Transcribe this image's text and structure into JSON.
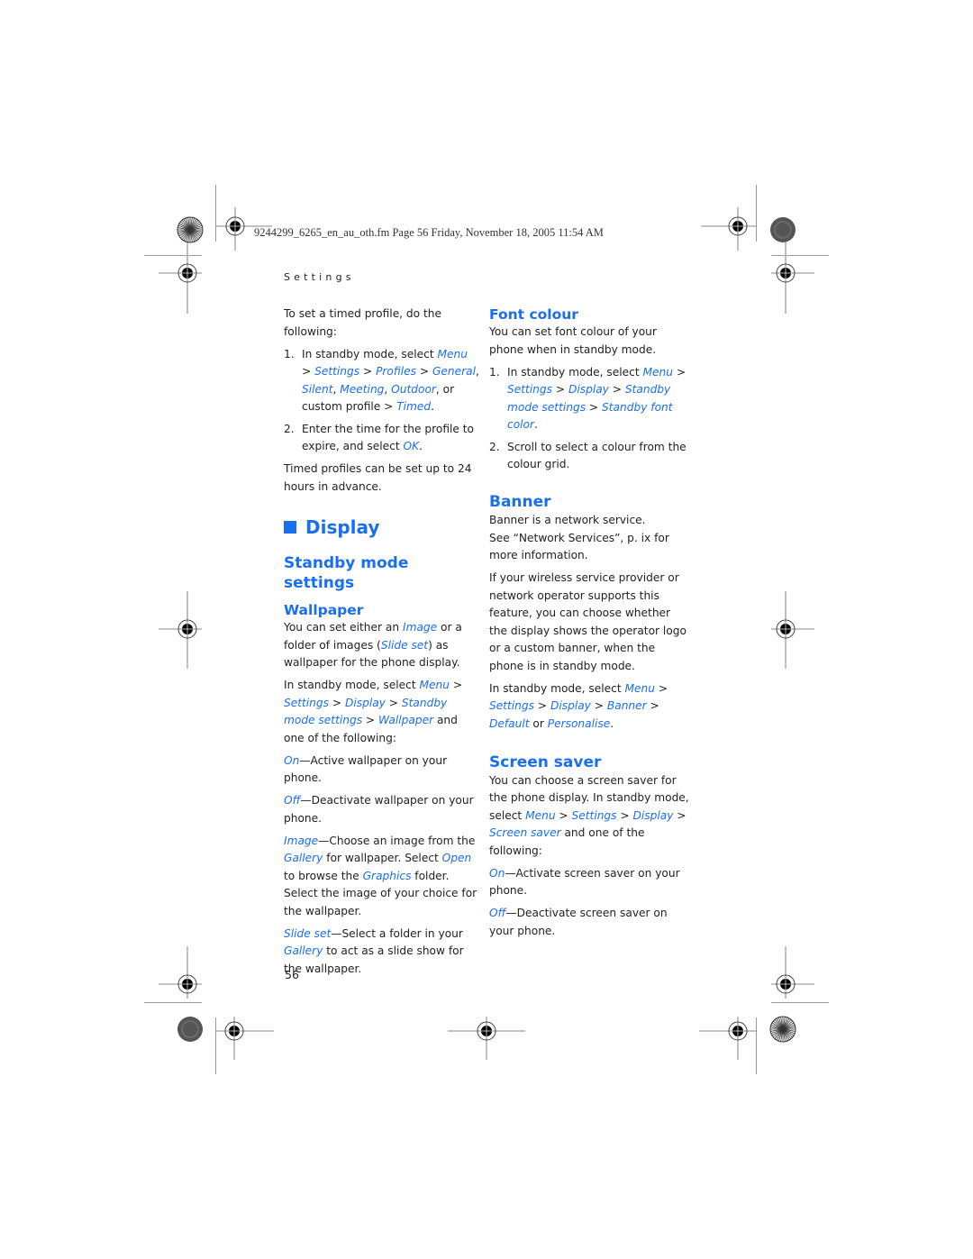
{
  "header": {
    "file_line": "9244299_6265_en_au_oth.fm  Page 56  Friday, November 18, 2005  11:54 AM",
    "running_head": "Settings"
  },
  "left_column": {
    "intro": "To set a timed profile, do the following:",
    "steps": [
      {
        "num": "1.",
        "parts": [
          {
            "t": "In standby mode, select "
          },
          {
            "t": "Menu",
            "link": true
          },
          {
            "t": " > "
          },
          {
            "t": "Settings",
            "link": true
          },
          {
            "t": " > "
          },
          {
            "t": "Profiles",
            "link": true
          },
          {
            "t": " > "
          },
          {
            "t": "General",
            "link": true
          },
          {
            "t": ", "
          },
          {
            "t": "Silent",
            "link": true
          },
          {
            "t": ", "
          },
          {
            "t": "Meeting",
            "link": true
          },
          {
            "t": ", "
          },
          {
            "t": "Outdoor",
            "link": true
          },
          {
            "t": ", or custom profile > "
          },
          {
            "t": "Timed",
            "link": true
          },
          {
            "t": "."
          }
        ]
      },
      {
        "num": "2.",
        "parts": [
          {
            "t": "Enter the time for the profile to expire, and select "
          },
          {
            "t": "OK",
            "link": true
          },
          {
            "t": "."
          }
        ]
      }
    ],
    "timed_note": "Timed profiles can be set up to 24 hours in advance.",
    "display_heading": "Display",
    "standby_heading": "Standby mode settings",
    "wallpaper_heading": "Wallpaper",
    "wallpaper_paras": [
      [
        {
          "t": "You can set either an "
        },
        {
          "t": "Image",
          "link": true
        },
        {
          "t": " or a folder of images ("
        },
        {
          "t": "Slide set",
          "link": true
        },
        {
          "t": ") as wallpaper for the phone display."
        }
      ],
      [
        {
          "t": "In standby mode, select "
        },
        {
          "t": "Menu",
          "link": true
        },
        {
          "t": " > "
        },
        {
          "t": "Settings",
          "link": true
        },
        {
          "t": " > "
        },
        {
          "t": "Display",
          "link": true
        },
        {
          "t": " > "
        },
        {
          "t": "Standby mode settings",
          "link": true
        },
        {
          "t": " > "
        },
        {
          "t": "Wallpaper",
          "link": true
        },
        {
          "t": " and one of the following:"
        }
      ],
      [
        {
          "t": "On",
          "link": true
        },
        {
          "t": "—Active wallpaper on your phone."
        }
      ],
      [
        {
          "t": "Off",
          "link": true
        },
        {
          "t": "—Deactivate wallpaper on your phone."
        }
      ],
      [
        {
          "t": "Image",
          "link": true
        },
        {
          "t": "—Choose an image from the "
        },
        {
          "t": "Gallery",
          "link": true
        },
        {
          "t": " for wallpaper. Select "
        },
        {
          "t": "Open",
          "link": true
        },
        {
          "t": " to browse the "
        },
        {
          "t": "Graphics",
          "link": true
        },
        {
          "t": " folder. Select the image of your choice for the wallpaper."
        }
      ],
      [
        {
          "t": "Slide set",
          "link": true
        },
        {
          "t": "—Select a folder in your "
        },
        {
          "t": "Gallery",
          "link": true
        },
        {
          "t": " to act as a slide show for the wallpaper."
        }
      ]
    ]
  },
  "right_column": {
    "font_heading": "Font colour",
    "font_intro": "You can set font colour of your phone when in standby mode.",
    "font_steps": [
      {
        "num": "1.",
        "parts": [
          {
            "t": "In standby mode, select "
          },
          {
            "t": "Menu",
            "link": true
          },
          {
            "t": " > "
          },
          {
            "t": "Settings",
            "link": true
          },
          {
            "t": " > "
          },
          {
            "t": "Display",
            "link": true
          },
          {
            "t": " > "
          },
          {
            "t": "Standby mode settings",
            "link": true
          },
          {
            "t": " > "
          },
          {
            "t": "Standby font color",
            "link": true
          },
          {
            "t": "."
          }
        ]
      },
      {
        "num": "2.",
        "parts": [
          {
            "t": "Scroll to select a colour from the colour grid."
          }
        ]
      }
    ],
    "banner_heading": "Banner",
    "banner_paras": [
      [
        {
          "t": "Banner is a network service."
        },
        {
          "br": true
        },
        {
          "t": "See “Network Services”, p. ix for more information."
        }
      ],
      [
        {
          "t": "If your wireless service provider or network operator supports this feature, you can choose whether the display shows the operator logo or a custom banner, when the phone is in standby mode."
        }
      ],
      [
        {
          "t": "In standby mode, select "
        },
        {
          "t": "Menu",
          "link": true
        },
        {
          "t": " > "
        },
        {
          "t": "Settings",
          "link": true
        },
        {
          "t": " > "
        },
        {
          "t": "Display",
          "link": true
        },
        {
          "t": " > "
        },
        {
          "t": "Banner",
          "link": true
        },
        {
          "t": " > "
        },
        {
          "t": "Default",
          "link": true
        },
        {
          "t": " or "
        },
        {
          "t": "Personalise",
          "link": true
        },
        {
          "t": "."
        }
      ]
    ],
    "screensaver_heading": "Screen saver",
    "screensaver_paras": [
      [
        {
          "t": "You can choose a screen saver for the phone display. In standby mode, select "
        },
        {
          "t": "Menu",
          "link": true
        },
        {
          "t": " > "
        },
        {
          "t": "Settings",
          "link": true
        },
        {
          "t": " > "
        },
        {
          "t": "Display",
          "link": true
        },
        {
          "t": " > "
        },
        {
          "t": "Screen saver",
          "link": true
        },
        {
          "t": " and one of the following:"
        }
      ],
      [
        {
          "t": "On",
          "link": true
        },
        {
          "t": "—Activate screen saver on your phone."
        }
      ],
      [
        {
          "t": "Off",
          "link": true
        },
        {
          "t": "—Deactivate screen saver on your phone."
        }
      ]
    ]
  },
  "footer": {
    "page_number": "56"
  },
  "colors": {
    "accent": "#1a6ef0",
    "text": "#222222",
    "crop_mark": "#9a9a9a"
  }
}
